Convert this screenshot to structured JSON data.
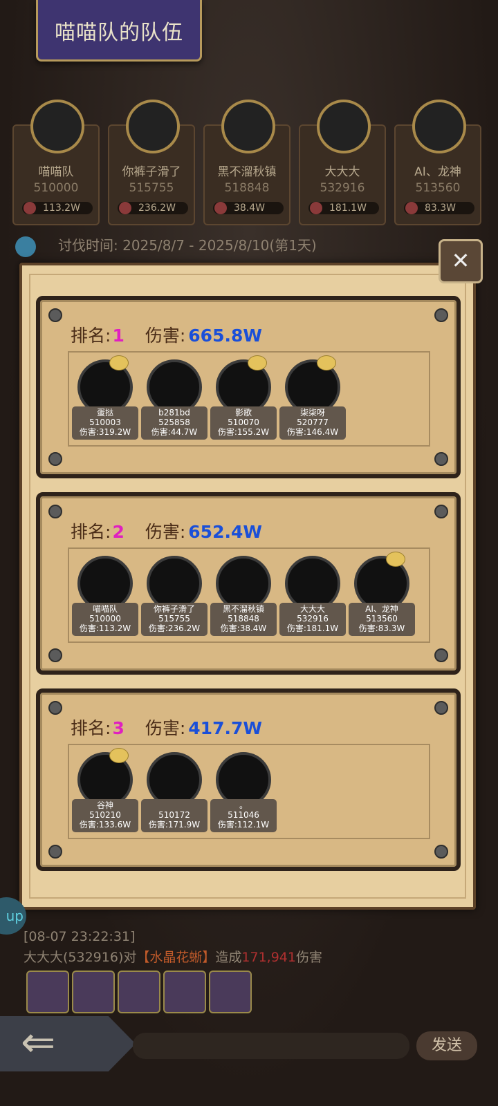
{
  "title": "喵喵队的队伍",
  "team": [
    {
      "name": "喵喵队",
      "id": "510000",
      "damage": "113.2W"
    },
    {
      "name": "你裤子滑了",
      "id": "515755",
      "damage": "236.2W"
    },
    {
      "name": "黑不溜秋镇",
      "id": "518848",
      "damage": "38.4W"
    },
    {
      "name": "大大大",
      "id": "532916",
      "damage": "181.1W"
    },
    {
      "name": "AI、龙神",
      "id": "513560",
      "damage": "83.3W"
    }
  ],
  "crusade_time": "讨伐时间: 2025/8/7 - 2025/8/10(第1天)",
  "rank_label": "排名:",
  "damage_label": "伤害:",
  "ranks": [
    {
      "rank": "1",
      "damage": "665.8W",
      "members": [
        {
          "name": "蛋挞",
          "id": "510003",
          "damage": "伤害:319.2W"
        },
        {
          "name": "b281bd",
          "id": "525858",
          "damage": "伤害:44.7W"
        },
        {
          "name": "影歌",
          "id": "510070",
          "damage": "伤害:155.2W"
        },
        {
          "name": "柒柒呀",
          "id": "520777",
          "damage": "伤害:146.4W"
        }
      ]
    },
    {
      "rank": "2",
      "damage": "652.4W",
      "members": [
        {
          "name": "喵喵队",
          "id": "510000",
          "damage": "伤害:113.2W"
        },
        {
          "name": "你裤子滑了",
          "id": "515755",
          "damage": "伤害:236.2W"
        },
        {
          "name": "黑不溜秋镇",
          "id": "518848",
          "damage": "伤害:38.4W"
        },
        {
          "name": "大大大",
          "id": "532916",
          "damage": "伤害:181.1W"
        },
        {
          "name": "AI、龙神",
          "id": "513560",
          "damage": "伤害:83.3W"
        }
      ]
    },
    {
      "rank": "3",
      "damage": "417.7W",
      "members": [
        {
          "name": "谷神",
          "id": "510210",
          "damage": "伤害:133.6W"
        },
        {
          "name": "",
          "id": "510172",
          "damage": "伤害:171.9W"
        },
        {
          "name": "。",
          "id": "511046",
          "damage": "伤害:112.1W"
        }
      ]
    }
  ],
  "log": {
    "timestamp": "[08-07 23:22:31]",
    "actor": "大大大(532916)对",
    "target": "【水晶花蜥】",
    "verb": "造成",
    "amount": "171,941",
    "suffix": "伤害"
  },
  "send_label": "发送",
  "side_label": "up",
  "colors": {
    "rank": "#e020c0",
    "damage": "#1a4fd8",
    "panel": "#d8b884"
  }
}
